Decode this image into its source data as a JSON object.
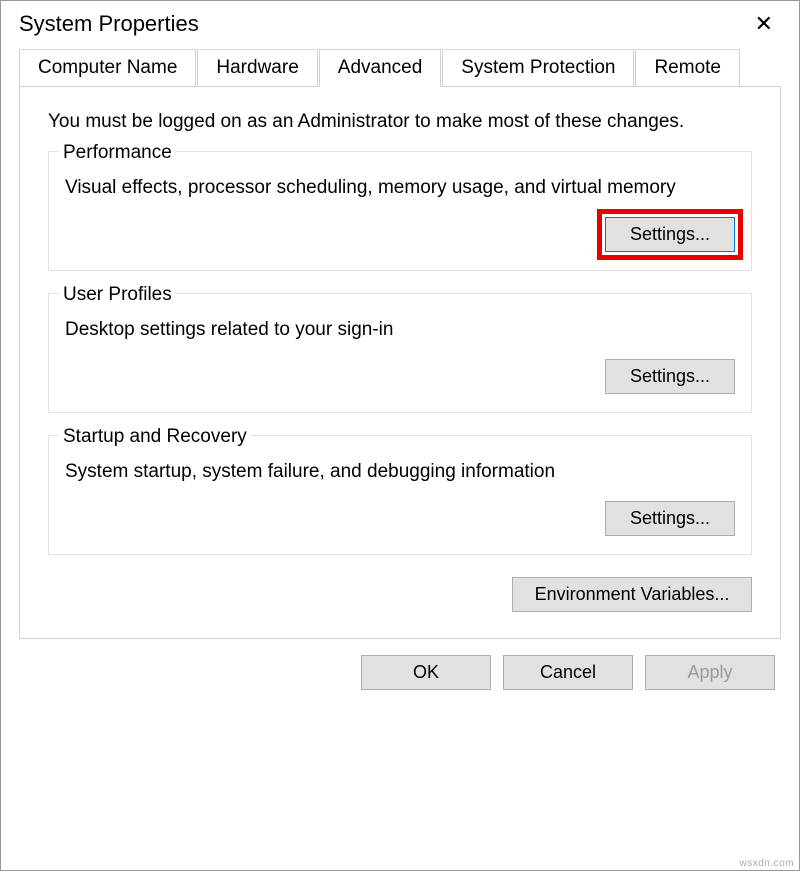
{
  "window": {
    "title": "System Properties"
  },
  "tabs": {
    "computer_name": "Computer Name",
    "hardware": "Hardware",
    "advanced": "Advanced",
    "system_protection": "System Protection",
    "remote": "Remote"
  },
  "panel": {
    "admin_note": "You must be logged on as an Administrator to make most of these changes.",
    "performance": {
      "legend": "Performance",
      "desc": "Visual effects, processor scheduling, memory usage, and virtual memory",
      "button": "Settings..."
    },
    "user_profiles": {
      "legend": "User Profiles",
      "desc": "Desktop settings related to your sign-in",
      "button": "Settings..."
    },
    "startup_recovery": {
      "legend": "Startup and Recovery",
      "desc": "System startup, system failure, and debugging information",
      "button": "Settings..."
    },
    "env_button": "Environment Variables..."
  },
  "footer": {
    "ok": "OK",
    "cancel": "Cancel",
    "apply": "Apply"
  },
  "watermark": "wsxdn.com"
}
